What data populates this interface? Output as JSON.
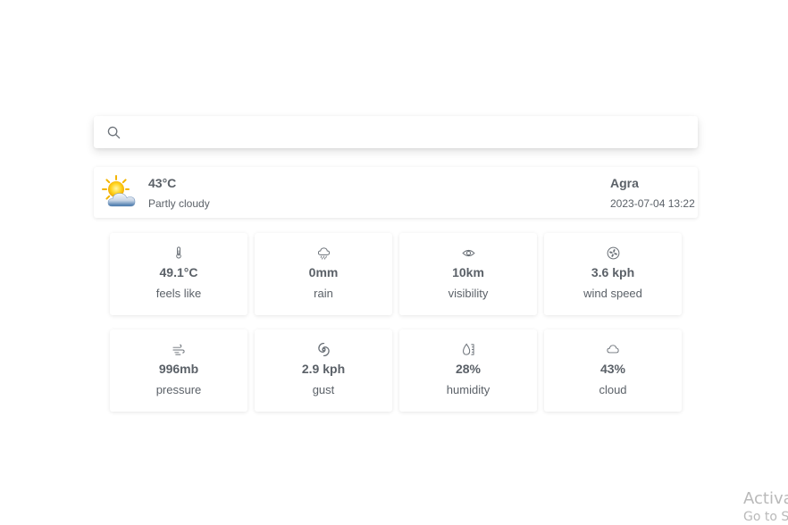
{
  "search": {
    "placeholder": "",
    "value": ""
  },
  "current": {
    "temperature": "43°C",
    "condition": "Partly cloudy",
    "location": "Agra",
    "datetime": "2023-07-04 13:22",
    "icon": "partly-cloudy-icon"
  },
  "stats": [
    {
      "icon": "thermometer-icon",
      "value": "49.1°C",
      "label": "feels like"
    },
    {
      "icon": "rain-icon",
      "value": "0mm",
      "label": "rain"
    },
    {
      "icon": "eye-icon",
      "value": "10km",
      "label": "visibility"
    },
    {
      "icon": "fan-icon",
      "value": "3.6 kph",
      "label": "wind speed"
    },
    {
      "icon": "pressure-icon",
      "value": "996mb",
      "label": "pressure"
    },
    {
      "icon": "gust-icon",
      "value": "2.9 kph",
      "label": "gust"
    },
    {
      "icon": "humidity-icon",
      "value": "28%",
      "label": "humidity"
    },
    {
      "icon": "cloud-icon",
      "value": "43%",
      "label": "cloud"
    }
  ],
  "watermark": {
    "title": "Activa",
    "subtitle": "Go to S"
  },
  "colors": {
    "text": "#5b6168",
    "icon": "#6b7178",
    "watermark": "#b9b9b9"
  }
}
